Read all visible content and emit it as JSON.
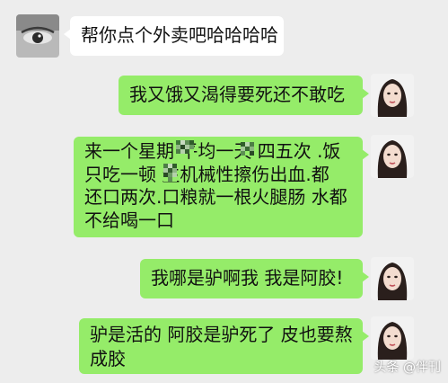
{
  "messages": [
    {
      "side": "left",
      "lines": [
        "帮你点个外卖吧哈哈哈哈"
      ]
    },
    {
      "side": "right",
      "lines": [
        "我又饿又渴得要死还不敢吃"
      ]
    },
    {
      "side": "right",
      "lines": [
        "来一个星期 平均一天  四五次 .饭",
        "只吃一顿    生机械性擦伤出血.都",
        "还口两次.口粮就一根火腿肠 水都",
        "不给喝一口"
      ]
    },
    {
      "side": "right",
      "lines": [
        "我哪是驴啊我 我是阿胶!"
      ]
    },
    {
      "side": "right",
      "lines": [
        "驴是活的 阿胶是驴死了 皮也要熬",
        "成胶"
      ]
    }
  ],
  "watermark": "头条 @伴刊",
  "colors": {
    "background": "#ededed",
    "sent_bubble": "#95ec69",
    "received_bubble": "#ffffff"
  }
}
